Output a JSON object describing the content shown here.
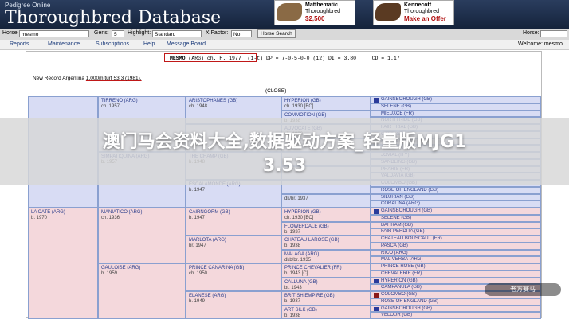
{
  "header": {
    "subtitle": "Pedigree Online",
    "title": "Thoroughbred Database",
    "ads": [
      {
        "name": "Matthematic",
        "line2": "Thoroughbred",
        "price": "$2,500"
      },
      {
        "name": "Kennecott",
        "line2": "Thoroughbred",
        "price": "Make an Offer"
      }
    ]
  },
  "toolbar": {
    "horse_label": "Horse:",
    "horse_value": "mesmo",
    "gens_label": "Gens:",
    "gens_value": "5",
    "highlight_label": "Highlight:",
    "highlight_value": "Standard",
    "xfactor_label": "X Factor:",
    "xfactor_value": "No",
    "search_button": "Horse Search",
    "right_label": "Horse:"
  },
  "menu": {
    "items": [
      "Reports",
      "Maintenance",
      "Subscriptions",
      "Help",
      "Message Board"
    ],
    "user": "Welcome: mesmo"
  },
  "report": {
    "horse_name": "MESMO",
    "horse_info": "(ARG) ch. H. 1977",
    "stats": "(1-t) DP = 7-0-5-0-0 (12) DI = 3.80     CD = 1.17",
    "record_prefix": "New Record Argentina",
    "record_value": "1.000m turf 53.3 (1981).",
    "close": "(CLOSE)"
  },
  "pedigree": {
    "gen1": [
      {
        "name": "",
        "info": "",
        "color": "blue"
      },
      {
        "name": "LA CATE (ARG)",
        "info": "b. 1970",
        "color": "pink"
      }
    ],
    "gen2": [
      {
        "name": "TIRRENO (ARG)",
        "info": "ch. 1957"
      },
      {
        "name": "SIMPATIQUINA (ARG)",
        "info": "b. 1957"
      },
      {
        "name": "MANIATICO (ARG)",
        "info": "ch. 1936"
      },
      {
        "name": "GAULOISE (ARG)",
        "info": "b. 1959"
      }
    ],
    "gen3": [
      {
        "name": "ARISTOPHANES (GB)",
        "info": "ch. 1948"
      },
      {
        "name": "",
        "info": ""
      },
      {
        "name": "THE CHAMP (GB)",
        "info": "b. 1948"
      },
      {
        "name": "ESCALAMONDE (ARG)",
        "info": "b. 1947"
      },
      {
        "name": "CAIRNGORM (GB)",
        "info": "b. 1947"
      },
      {
        "name": "MARLOTA (ARG)",
        "info": "br. 1947"
      },
      {
        "name": "PRINCE CANARINA (GB)",
        "info": "ch. 1950"
      },
      {
        "name": "ELANESE (ARG)",
        "info": "b. 1949"
      }
    ],
    "gen4": [
      {
        "name": "HYPERION (GB)",
        "info": "ch. 1930 [BC]"
      },
      {
        "name": "COMMOTION (GB)",
        "info": "b. 1938"
      },
      {
        "name": "ADVOCATE (GB)",
        "info": "ch. 1930"
      },
      {
        "name": "",
        "info": ""
      },
      {
        "name": "",
        "info": ""
      },
      {
        "name": "",
        "info": ""
      },
      {
        "name": "",
        "info": ""
      },
      {
        "name": "",
        "info": "dk/br. 1937"
      },
      {
        "name": "HYPERION (GB)",
        "info": "ch. 1930 [BC]"
      },
      {
        "name": "FLOWERDALE (GB)",
        "info": "b. 1937"
      },
      {
        "name": "CHATEAU LAROSE (GB)",
        "info": "b. 1938"
      },
      {
        "name": "MALAGA (ARG)",
        "info": "dkb/br. 1935"
      },
      {
        "name": "PRINCE CHEVALIER (FR)",
        "info": "b. 1943 [C]"
      },
      {
        "name": "CALLUNA (GB)",
        "info": "br. 1943"
      },
      {
        "name": "BRITISH EMPIRE (GB)",
        "info": "b. 1937"
      },
      {
        "name": "ART SILK (GB)",
        "info": "b. 1938"
      }
    ],
    "gen5": [
      {
        "name": "GAINSBOROUGH (GB)",
        "info": "b. 1915 [C]",
        "sw": "#2a3a9a"
      },
      {
        "name": "SELENE (GB)",
        "info": "b. 1919 *",
        "sw": ""
      },
      {
        "name": "MIEUXCE (FR)",
        "info": "b. 1933 [P]",
        "sw": ""
      },
      {
        "name": "NORTH RIDE (GB)",
        "info": "b. 1931",
        "sw": ""
      },
      {
        "name": "FAIR TRIAL (GB)",
        "info": "ch. 1932 [B]",
        "sw": ""
      },
      {
        "name": "GALA (GB)",
        "info": "b. 1923",
        "sw": ""
      },
      {
        "name": "FAIRWAY (GB)",
        "info": "b. 1925 [C]",
        "sw": ""
      },
      {
        "name": "AMBER (GB)",
        "info": "ch. 1930",
        "sw": ""
      },
      {
        "name": "JOVIAL (ITY)",
        "info": "ch. 1933",
        "sw": ""
      },
      {
        "name": "SANDLING (GB)",
        "info": "br. 1933",
        "sw": ""
      },
      {
        "name": "PHARIS (FR)",
        "info": "br. 1936",
        "sw": ""
      },
      {
        "name": "VALDAVIA (GB)",
        "info": "b. 1939",
        "sw": ""
      },
      {
        "name": "COLOMBO (GB)",
        "info": "b. 1931 [C]",
        "sw": ""
      },
      {
        "name": "ROSE OF ENGLAND (GB)",
        "info": "b. 1927",
        "sw": ""
      },
      {
        "name": "SILURIAN (GB)",
        "info": "b. 1936",
        "sw": ""
      },
      {
        "name": "CORALINA (ARG)",
        "info": "b. 1930",
        "sw": ""
      },
      {
        "name": "GAINSBOROUGH (GB)",
        "info": "b. 1915 [C]",
        "sw": "#2a3a9a"
      },
      {
        "name": "SELENE (GB)",
        "info": "b. 1919 *",
        "sw": ""
      },
      {
        "name": "BAHRAM (GB)",
        "info": "b. 1932 [BC]",
        "sw": ""
      },
      {
        "name": "FAIR PERDITA (GB)",
        "info": "b. 1926",
        "sw": ""
      },
      {
        "name": "CHATEAU BOUSCAUT (FR)",
        "info": "b. 1927 [P]",
        "sw": ""
      },
      {
        "name": "PASCA (GB)",
        "info": "b. 1928",
        "sw": ""
      },
      {
        "name": "RICO (ARG)",
        "info": "b. 1923",
        "sw": ""
      },
      {
        "name": "MAL VERBA (ARG)",
        "info": "b. 1919",
        "sw": ""
      },
      {
        "name": "PRINCE ROSE (GB)",
        "info": "b. 1928 [C]",
        "sw": ""
      },
      {
        "name": "CHEVALERIE (FR)",
        "info": "b. 1933",
        "sw": ""
      },
      {
        "name": "HYPERION (GB)",
        "info": "ch. 1930 [BC]",
        "sw": "#2a3a9a"
      },
      {
        "name": "CAMPANULA (GB)",
        "info": "b. 1931",
        "sw": ""
      },
      {
        "name": "COLOMBO (GB)",
        "info": "b. 1931 [C]",
        "sw": "#8a1a1a"
      },
      {
        "name": "ROSE OF ENGLAND (GB)",
        "info": "b. 1927",
        "sw": ""
      },
      {
        "name": "GAINSBOROUGH (GB)",
        "info": "b. 1915 [C]",
        "sw": "#2a3a9a"
      },
      {
        "name": "VELOUR (GB)",
        "info": "b. 1922",
        "sw": ""
      }
    ]
  },
  "overlay": {
    "headline_line1": "澳门马会资料大全,数据驱动方案_轻量版MJG1",
    "headline_line2": "3.53",
    "watermark": "老方赛马"
  }
}
